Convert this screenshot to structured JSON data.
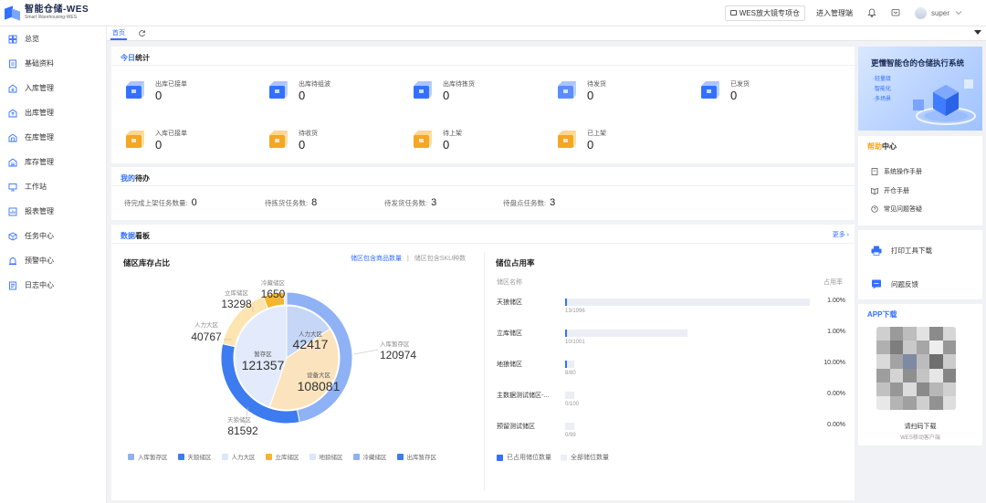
{
  "header": {
    "logo_title": "智能仓储-WES",
    "logo_subtitle": "Smart Warehousing-WES",
    "screen_button": "WES放大镜专项仓",
    "admin_link": "进入管理端",
    "username": "super"
  },
  "sidebar": {
    "items": [
      {
        "label": "总览",
        "icon": "overview-icon"
      },
      {
        "label": "基础资料",
        "icon": "basic-data-icon"
      },
      {
        "label": "入库管理",
        "icon": "inbound-icon"
      },
      {
        "label": "出库管理",
        "icon": "outbound-icon"
      },
      {
        "label": "在库管理",
        "icon": "in-stock-icon"
      },
      {
        "label": "库存管理",
        "icon": "inventory-icon"
      },
      {
        "label": "工作站",
        "icon": "workstation-icon"
      },
      {
        "label": "报表管理",
        "icon": "report-icon"
      },
      {
        "label": "任务中心",
        "icon": "task-icon"
      },
      {
        "label": "预警中心",
        "icon": "alert-icon"
      },
      {
        "label": "日志中心",
        "icon": "log-icon"
      }
    ]
  },
  "tabs": {
    "home": "首页"
  },
  "today": {
    "title_hl": "今日",
    "title_rest": "统计",
    "stats": [
      {
        "label": "出库已接单",
        "value": "0",
        "color": "#3370ff"
      },
      {
        "label": "出库待组波",
        "value": "0",
        "color": "#3370ff"
      },
      {
        "label": "出库待拣货",
        "value": "0",
        "color": "#3370ff"
      },
      {
        "label": "待发货",
        "value": "0",
        "color": "#5b8dff"
      },
      {
        "label": "已发货",
        "value": "0",
        "color": "#3370ff"
      },
      {
        "label": "入库已接单",
        "value": "0",
        "color": "#f5a623"
      },
      {
        "label": "待收货",
        "value": "0",
        "color": "#f5a623"
      },
      {
        "label": "待上架",
        "value": "0",
        "color": "#f5a623"
      },
      {
        "label": "已上架",
        "value": "0",
        "color": "#f5a623"
      }
    ]
  },
  "todo": {
    "title_hl": "我的",
    "title_rest": "待办",
    "items": [
      {
        "label": "待完成上架任务数量:",
        "value": "0"
      },
      {
        "label": "待拣货任务数:",
        "value": "8"
      },
      {
        "label": "待发货任务数:",
        "value": "3"
      },
      {
        "label": "待盘点任务数:",
        "value": "3"
      }
    ]
  },
  "board": {
    "title_hl": "数据",
    "title_rest": "看板",
    "more": "更多",
    "area_title": "储区库存占比",
    "toggle_active": "储区包含商品数量",
    "toggle_sep": "|",
    "toggle_other": "储区包含SKU种数",
    "occupancy_title": "储位占用率",
    "col_name": "储区名称",
    "col_rate": "占用率",
    "occupancy_rows": [
      {
        "name": "天狼储区",
        "used": 13,
        "total": 1996,
        "count_label": "13/1996",
        "rate": "1.00%",
        "fraction": 0.0065
      },
      {
        "name": "立库储区",
        "used": 10,
        "total": 1001,
        "count_label": "10/1001",
        "rate": "1.00%",
        "fraction": 0.01
      },
      {
        "name": "地狼储区",
        "used": 8,
        "total": 80,
        "count_label": "8/80",
        "rate": "10.00%",
        "fraction": 0.1
      },
      {
        "name": "主数据测试储区-...",
        "used": 0,
        "total": 100,
        "count_label": "0/100",
        "rate": "0.00%",
        "fraction": 0
      },
      {
        "name": "预留测试储区",
        "used": 0,
        "total": 99,
        "count_label": "0/99",
        "rate": "0.00%",
        "fraction": 0
      }
    ],
    "occ_legend_used": "已占用储位数量",
    "occ_legend_free": "全部储位数量"
  },
  "chart_data": {
    "type": "pie",
    "title": "储区库存占比",
    "outer_ring": [
      {
        "name": "入库暂存区",
        "value": 120974,
        "color": "#8fb1f5"
      },
      {
        "name": "天狼储区",
        "value": 81592,
        "color": "#3d7bf0"
      },
      {
        "name": "人力大区",
        "value": 40767,
        "color": "#fde4b0"
      },
      {
        "name": "立库储区",
        "value": 13298,
        "color": "#f7b52c"
      },
      {
        "name": "冷藏储区",
        "value": 1650,
        "color": "#dfe7fb"
      }
    ],
    "inner_pie": [
      {
        "name": "人力大区",
        "value": 42417,
        "color": "#c5d6f7"
      },
      {
        "name": "设备大区",
        "value": 108081,
        "color": "#fbe4bd"
      },
      {
        "name": "暂存区",
        "value": 121357,
        "color": "#e2eafb"
      }
    ],
    "legend": [
      {
        "name": "入库暂存区",
        "color": "#8fb1f5"
      },
      {
        "name": "天狼储区",
        "color": "#3d7bf0"
      },
      {
        "name": "人力大区",
        "color": "#dce6fa"
      },
      {
        "name": "立库储区",
        "color": "#f7b52c"
      },
      {
        "name": "地狼储区",
        "color": "#dce6fa"
      },
      {
        "name": "冷藏储区",
        "color": "#8fb1f5"
      },
      {
        "name": "出库暂存区",
        "color": "#3d7bf0"
      }
    ]
  },
  "right": {
    "banner_title": "更懂智能仓的仓储执行系统",
    "banner_points": [
      "·轻量级",
      "·智能化",
      "·多场景"
    ],
    "help_title_hl": "帮助",
    "help_title_rest": "中心",
    "help_items": [
      "系统操作手册",
      "开仓手册",
      "常见问题答疑"
    ],
    "print_tool": "打印工具下载",
    "feedback": "问题反馈",
    "app_title": "APP下载",
    "app_scan": "请扫码下载",
    "app_sub": "WES移动客户端"
  },
  "colors": {
    "accent": "#3370ff",
    "warning": "#f5a623"
  }
}
